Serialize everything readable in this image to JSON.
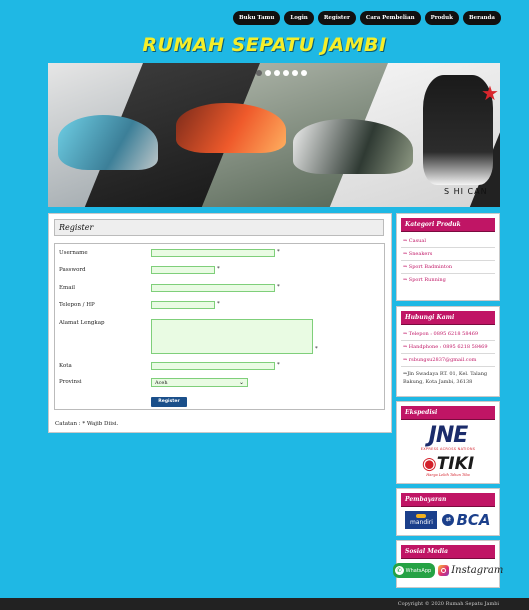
{
  "nav": [
    "Buku Tamu",
    "Login",
    "Register",
    "Cara Pembelian",
    "Produk",
    "Beranda"
  ],
  "site_title": "RUMAH SEPATU JAMBI",
  "banner": {
    "caption": "S HI CAN",
    "slide_count": 6,
    "active_slide": 1
  },
  "register": {
    "heading": "Register",
    "labels": {
      "username": "Username",
      "password": "Password",
      "email": "Email",
      "telepon": "Telepon / HP",
      "alamat": "Alamat Lengkap",
      "kota": "Kota",
      "provinsi": "Provinsi"
    },
    "required_mark": "*",
    "provinsi_value": "Aceh",
    "submit_label": "Register",
    "note": "Catatan : * Wajib Diisi."
  },
  "sidebar": {
    "kategori": {
      "title": "Kategori Produk",
      "items": [
        "⇒ Casual",
        "⇒ Sneakers",
        "⇒ Sport Badminton",
        "⇒ Sport Running"
      ]
    },
    "hubungi": {
      "title": "Hubungi Kami",
      "telepon": "⇒ Telepon : 0895 6218 58469",
      "handphone": "⇒ Handphone : 0895 6218 58469",
      "email": "⇒ rsbungsu2837@gmail.com",
      "alamat": "⇒Jln Swadaya RT. 01, Kel. Talang Bakung, Kota Jambi, 36138"
    },
    "ekspedisi": {
      "title": "Ekspedisi",
      "jne": "JNE",
      "jne_sub": "EXPRESS ACROSS NATIONS",
      "tiki": "TIKI",
      "tiki_sub": "Hanya Lebih Tahun Tiba"
    },
    "pembayaran": {
      "title": "Pembayaran",
      "mandiri": "mandiri",
      "bca": "BCA"
    },
    "sosial": {
      "title": "Sosial Media",
      "whatsapp": "WhatsApp",
      "instagram": "Instagram"
    }
  },
  "footer": "Copyright © 2020 Rumah Sepatu Jambi"
}
